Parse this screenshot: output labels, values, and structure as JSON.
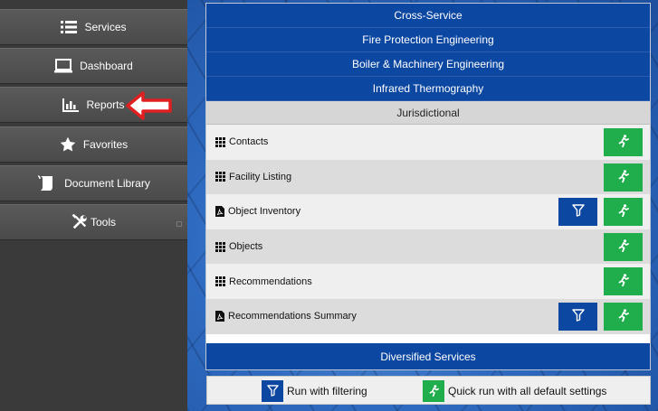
{
  "sidebar": {
    "items": [
      {
        "label": "Services",
        "icon": "list-icon"
      },
      {
        "label": "Dashboard",
        "icon": "laptop-icon"
      },
      {
        "label": "Reports",
        "icon": "bar-chart-icon"
      },
      {
        "label": "Favorites",
        "icon": "star-icon"
      },
      {
        "label": "Document Library",
        "icon": "scroll-icon"
      },
      {
        "label": "Tools",
        "icon": "wrench-screwdriver-icon"
      }
    ],
    "annotation_arrow_color": "#e02020"
  },
  "services": {
    "headers": [
      "Cross-Service",
      "Fire Protection Engineering",
      "Boiler & Machinery Engineering",
      "Infrared Thermography"
    ],
    "active_section": "Jurisdictional",
    "reports": [
      {
        "label": "Contacts",
        "icon": "grid-icon",
        "has_filter": false
      },
      {
        "label": "Facility Listing",
        "icon": "grid-icon",
        "has_filter": false
      },
      {
        "label": "Object Inventory",
        "icon": "pdf-icon",
        "has_filter": true
      },
      {
        "label": "Objects",
        "icon": "grid-icon",
        "has_filter": false
      },
      {
        "label": "Recommendations",
        "icon": "grid-icon",
        "has_filter": false
      },
      {
        "label": "Recommendations Summary",
        "icon": "pdf-icon",
        "has_filter": true
      }
    ],
    "footer_header": "Diversified Services"
  },
  "legend": {
    "filter_label": "Run with filtering",
    "quick_label": "Quick run with all default settings"
  },
  "colors": {
    "primary_blue": "#0c47a1",
    "run_green": "#1fae4b",
    "sidebar_bg": "#3a3a3a"
  }
}
